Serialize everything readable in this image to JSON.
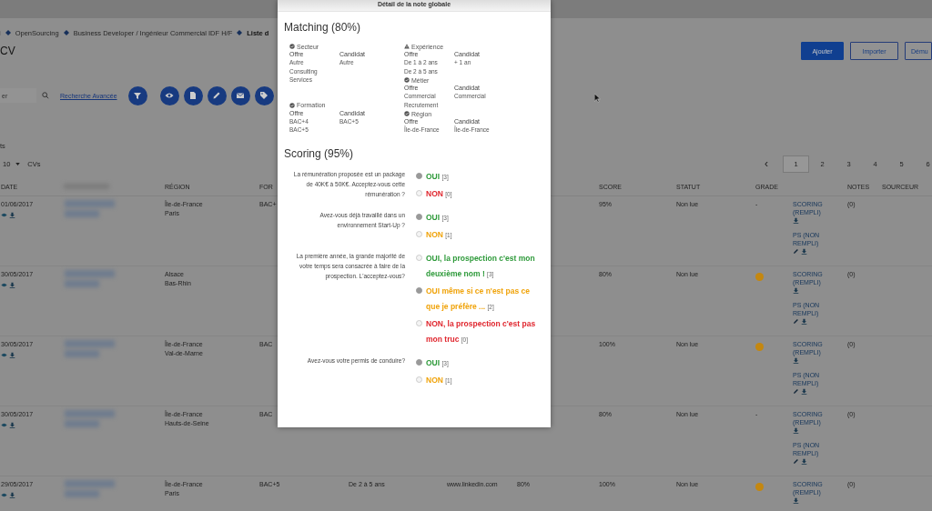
{
  "breadcrumb": [
    "i",
    "OpenSourcing",
    "Business Developer / Ingénieur Commercial IDF H/F",
    "Liste d"
  ],
  "page_title": "CV",
  "header_buttons": [
    {
      "label": "Ajouter",
      "kind": "primary"
    },
    {
      "label": "Importer",
      "kind": "outline"
    },
    {
      "label": "Dému",
      "kind": "outline"
    }
  ],
  "search": {
    "placeholder": "er"
  },
  "advanced_search_link": "Recherche Avancée",
  "results_label": "ts",
  "page_size": {
    "value": "10",
    "unit": "CVs"
  },
  "pagination": {
    "prev": "‹",
    "pages": [
      {
        "label": "1",
        "selected": true
      },
      {
        "label": "2",
        "selected": false
      },
      {
        "label": "3",
        "selected": false
      },
      {
        "label": "4",
        "selected": false
      },
      {
        "label": "5",
        "selected": false
      },
      {
        "label": "6",
        "selected": false
      }
    ]
  },
  "table": {
    "header": {
      "date": "DATE",
      "region": "RÉGION",
      "formation": "FOR",
      "score": "SCORE",
      "statut": "STATUT",
      "grade": "GRADE",
      "notes": "NOTES",
      "sourceur": "SOURCEUR"
    },
    "rows": [
      {
        "date": "01/06/2017",
        "region": [
          "Île-de-France",
          "Paris"
        ],
        "formation": "BAC+",
        "score": "95%",
        "statut": "Non lue",
        "grade": {
          "kind": "text",
          "text": "-"
        },
        "docs": [
          {
            "label": "SCORING (REMPLI)",
            "editable": false
          },
          {
            "label": "PS (NON REMPLI)",
            "editable": true
          }
        ],
        "notes": "(0)"
      },
      {
        "date": "30/05/2017",
        "region": [
          "Alsace",
          "Bas-Rhin"
        ],
        "score": "80%",
        "statut": "Non lue",
        "grade": {
          "kind": "dot",
          "color": "#c4870f"
        },
        "docs": [
          {
            "label": "SCORING (REMPLI)",
            "editable": false
          },
          {
            "label": "PS (NON REMPLI)",
            "editable": true
          }
        ],
        "notes": "(0)"
      },
      {
        "date": "30/05/2017",
        "region": [
          "Île-de-France",
          "Val-de-Marne"
        ],
        "formation": "BAC",
        "score": "100%",
        "statut": "Non lue",
        "grade": {
          "kind": "dot",
          "color": "#c4870f"
        },
        "docs": [
          {
            "label": "SCORING (REMPLI)",
            "editable": false
          },
          {
            "label": "PS (NON REMPLI)",
            "editable": true
          }
        ],
        "notes": "(0)"
      },
      {
        "date": "30/05/2017",
        "region": [
          "Île-de-France",
          "Hauts-de-Seine"
        ],
        "formation": "BAC",
        "score": "80%",
        "statut": "Non lue",
        "grade": {
          "kind": "text",
          "text": "-"
        },
        "docs": [
          {
            "label": "SCORING (REMPLI)",
            "editable": false
          },
          {
            "label": "PS (NON REMPLI)",
            "editable": true
          }
        ],
        "notes": "(0)"
      },
      {
        "date": "29/05/2017",
        "region": [
          "Île-de-France",
          "Paris"
        ],
        "formation": "BAC+5",
        "experience": "De 2 à 5 ans",
        "source": "www.linkedin.com",
        "matching": "80%",
        "score": "100%",
        "statut": "Non lue",
        "grade": {
          "kind": "dot",
          "color": "#c4870f"
        },
        "docs": [
          {
            "label": "SCORING (REMPLI)",
            "editable": false
          }
        ],
        "notes": "(0)"
      }
    ]
  },
  "modal": {
    "title": "Détail de la note globale",
    "matching": {
      "title": "Matching (80%)",
      "columns": [
        [
          {
            "name": "Secteur",
            "kind": "ok",
            "offer_label": "Offre",
            "candidate_label": "Candidat",
            "offer": [
              "Autre",
              "Consulting",
              "Services"
            ],
            "candidate": [
              "Autre"
            ]
          },
          {
            "name": "Formation",
            "kind": "ok",
            "offer_label": "Offre",
            "candidate_label": "Candidat",
            "offer": [
              "BAC+4",
              "BAC+5"
            ],
            "candidate": [
              "BAC+5"
            ]
          }
        ],
        [
          {
            "name": "Expérience",
            "kind": "warning",
            "offer_label": "Offre",
            "candidate_label": "Candidat",
            "offer": [
              "De 1 à 2 ans",
              "De 2 à 5 ans"
            ],
            "candidate": [
              "+ 1 an"
            ]
          },
          {
            "name": "Métier",
            "kind": "ok",
            "offer_label": "Offre",
            "candidate_label": "Candidat",
            "offer": [
              "Commercial",
              "Recrutement"
            ],
            "candidate": [
              "Commercial"
            ]
          },
          {
            "name": "Région",
            "kind": "ok",
            "offer_label": "Offre",
            "candidate_label": "Candidat",
            "offer": [
              "Île-de-France"
            ],
            "candidate": [
              "Île-de-France"
            ]
          }
        ]
      ]
    },
    "scoring": {
      "title": "Scoring (95%)",
      "questions": [
        {
          "text": "La rémunération proposée est un package de 40K€ à 50K€. Acceptez-vous cette rémunération ?",
          "answers": [
            {
              "text": "OUI",
              "points": "[3]",
              "color": "#2e9a3a",
              "selected": true
            },
            {
              "text": "NON",
              "points": "[0]",
              "color": "#e0262e",
              "selected": false
            }
          ]
        },
        {
          "text": "Avez-vous déjà travaillé dans un environnement Start-Up ?",
          "answers": [
            {
              "text": "OUI",
              "points": "[3]",
              "color": "#2e9a3a",
              "selected": true
            },
            {
              "text": "NON",
              "points": "[1]",
              "color": "#f0a30a",
              "selected": false
            }
          ]
        },
        {
          "text": "La première année, la grande majorité de votre temps sera consacrée à faire de la prospection. L'acceptez-vous?",
          "answers": [
            {
              "text": "OUI, la prospection c'est mon deuxième nom !",
              "points": "[3]",
              "color": "#2e9a3a",
              "selected": false
            },
            {
              "text": "OUI même si ce n'est pas ce que je préfère ...",
              "points": "[2]",
              "color": "#f0a30a",
              "selected": true
            },
            {
              "text": "NON, la prospection c'est pas mon truc",
              "points": "[0]",
              "color": "#e0262e",
              "selected": false
            }
          ]
        },
        {
          "text": "Avez-vous votre permis de conduire?",
          "answers": [
            {
              "text": "OUI",
              "points": "[3]",
              "color": "#2e9a3a",
              "selected": true
            },
            {
              "text": "NON",
              "points": "[1]",
              "color": "#f0a30a",
              "selected": false
            }
          ]
        }
      ]
    }
  }
}
